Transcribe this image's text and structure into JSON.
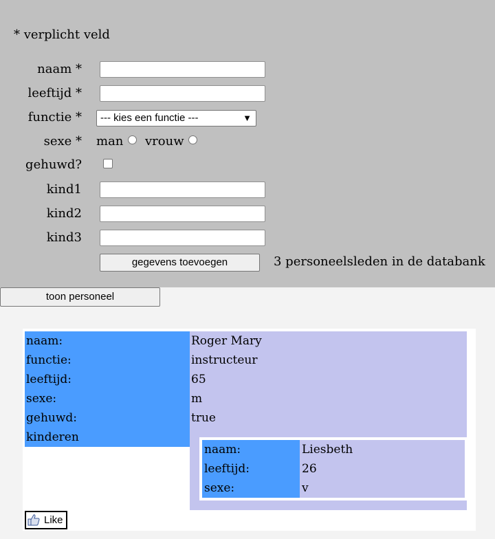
{
  "form": {
    "required_note": "* verplicht veld",
    "fields": {
      "naam_label": "naam *",
      "leeftijd_label": "leeftijd *",
      "functie_label": "functie *",
      "functie_selected": "--- kies een functie ---",
      "sexe_label": "sexe *",
      "sexe_option_man": "man",
      "sexe_option_vrouw": "vrouw",
      "gehuwd_label": "gehuwd?",
      "kind1_label": "kind1",
      "kind2_label": "kind2",
      "kind3_label": "kind3"
    },
    "submit_label": "gegevens toevoegen",
    "status_text": "3 personeelsleden in de databank"
  },
  "show_button_label": "toon personeel",
  "employee": {
    "rows": [
      {
        "key": "naam:",
        "value": "Roger Mary"
      },
      {
        "key": "functie:",
        "value": "instructeur"
      },
      {
        "key": "leeftijd:",
        "value": "65"
      },
      {
        "key": "sexe:",
        "value": "m"
      },
      {
        "key": "gehuwd:",
        "value": "true"
      },
      {
        "key": "kinderen",
        "value": ""
      }
    ],
    "children": [
      {
        "rows": [
          {
            "key": "naam:",
            "value": "Liesbeth"
          },
          {
            "key": "leeftijd:",
            "value": "26"
          },
          {
            "key": "sexe:",
            "value": "v"
          }
        ]
      }
    ]
  },
  "like_button": {
    "label": "Like",
    "icon": "thumbs-up-icon"
  },
  "colors": {
    "form_background": "#c0c0c0",
    "key_background": "#4a9cff",
    "value_background": "#c3c4ee"
  }
}
